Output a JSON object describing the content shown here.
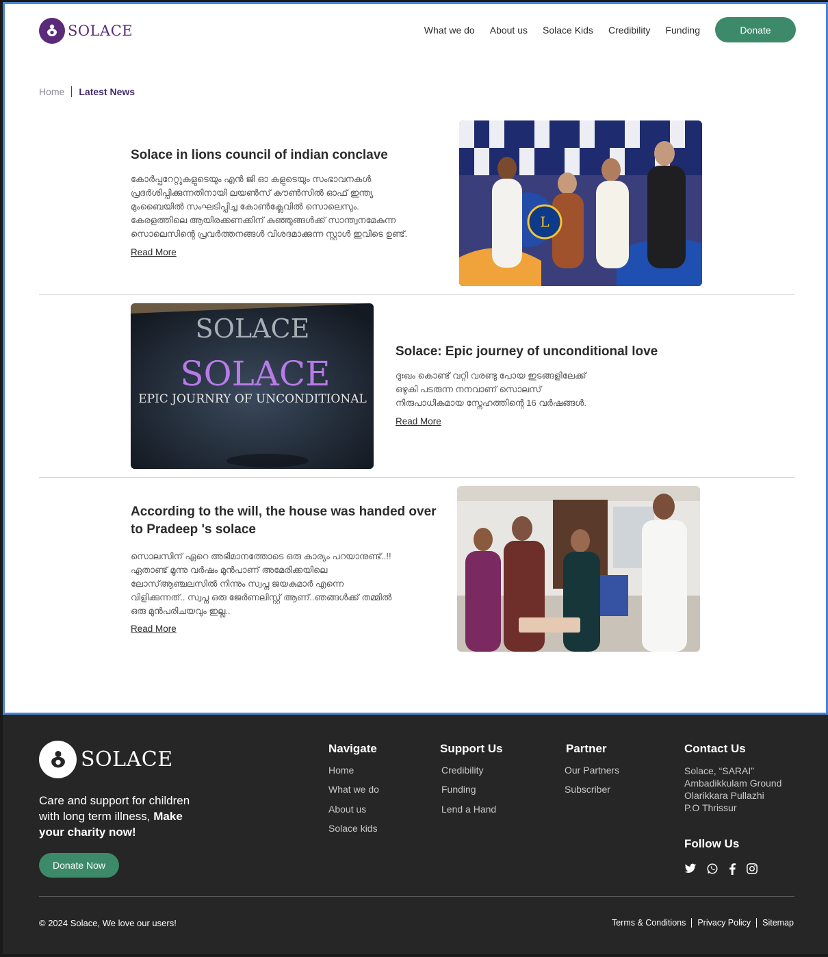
{
  "header": {
    "logo_text": "SOLACE",
    "nav": [
      "What we do",
      "About us",
      "Solace Kids",
      "Credibility",
      "Funding"
    ],
    "donate_label": "Donate"
  },
  "breadcrumb": {
    "home": "Home",
    "current": "Latest News"
  },
  "news": [
    {
      "title": "Solace in lions council of indian conclave",
      "body": [
        "കോര്‍പ്പറേറ്റുകളുടെയും എൻ ജി ഓ കളുടെയും സംഭാവനകൾ",
        "പ്രദര്‍ശിപ്പിക്കുന്നതിനായി ലയൺസ് കൗൺസിൽ ഓഫ് ഇന്ത്യ",
        "മുംബൈയിൽ സംഘടിപ്പിച്ച കോൺക്ലേവിൽ സൊലെസും.",
        "കേരളത്തിലെ ആയിരക്കണക്കിന് കുഞ്ഞുങ്ങൾക്ക് സാന്ത്വനമേകുന്ന",
        "സൊലെസിന്റെ പ്രവര്‍ത്തനങ്ങൾ വിശദമാക്കുന്ന സ്റ്റാൾ ഇവിടെ ഉണ്ട്."
      ],
      "read_more": "Read More"
    },
    {
      "title": "Solace: Epic journey of unconditional love",
      "body": [
        "ദുഃഖം കൊണ്ട് വറ്റി വരണ്ടു പോയ ഇടങ്ങളിലേക്ക്",
        "ഒഴുകി പടരുന്ന നനവാണ് സൊലസ്",
        "നിരുപാധികമായ സ്നേഹത്തിന്റെ 16 വർഷങ്ങൾ."
      ],
      "read_more": "Read More",
      "image_text": {
        "top": "SOLACE",
        "main": "SOLACE",
        "sub": "EPIC JOURNRY OF UNCONDITIONAL"
      }
    },
    {
      "title_lines": [
        "According to the will, the house was handed over",
        "to Pradeep 's solace"
      ],
      "body": [
        "സൊലസിന് ഏറെ അഭിമാനത്തോടെ ഒരു കാര്യം പറയാനുണ്ട്..!!",
        "ഏതാണ്ട് മൂന്നു വർഷം മുൻപാണ് അമേരിക്കയിലെ",
        "ലോസ്ആഞ്ചലസിൽ നിന്നും സ്വപ്ന ജയകുമാർ എന്നെ",
        "വിളിക്കുന്നത്.. സ്വപ്ന ഒരു ജേർണലിസ്റ്റ് ആണ്..ഞങ്ങൾക്ക് തമ്മിൽ",
        "ഒരു മുൻപരിചയവും ഇല്ല.."
      ],
      "read_more": "Read More"
    }
  ],
  "footer": {
    "logo_text": "SOLACE",
    "tagline_plain": "Care and support for children with long term illness,",
    "tagline_bold": "Make your charity now!",
    "donate_label": "Donate Now",
    "navigate": {
      "title": "Navigate",
      "links": [
        "Home",
        "What we do",
        "About us",
        "Solace kids"
      ]
    },
    "support": {
      "title": "Support Us",
      "links": [
        "Credibility",
        "Funding",
        "Lend a Hand"
      ]
    },
    "partner": {
      "title": "Partner",
      "links": [
        "Our Partners",
        "Subscriber"
      ]
    },
    "contact": {
      "title": "Contact Us",
      "address": [
        "Solace, “SARAI”",
        "Ambadikkulam Ground",
        "Olarikkara Pullazhi",
        "P.O Thrissur"
      ]
    },
    "follow_title": "Follow Us",
    "social_icons": [
      "twitter-icon",
      "whatsapp-icon",
      "facebook-icon",
      "instagram-icon"
    ],
    "copyright": "© 2024 Solace, We love our users!",
    "legal": [
      "Terms & Conditions",
      "Privacy Policy",
      "Sitemap"
    ]
  },
  "colors": {
    "brand_purple": "#5b2a7a",
    "accent_green": "#3d8a6a",
    "footer_bg": "#262626"
  }
}
